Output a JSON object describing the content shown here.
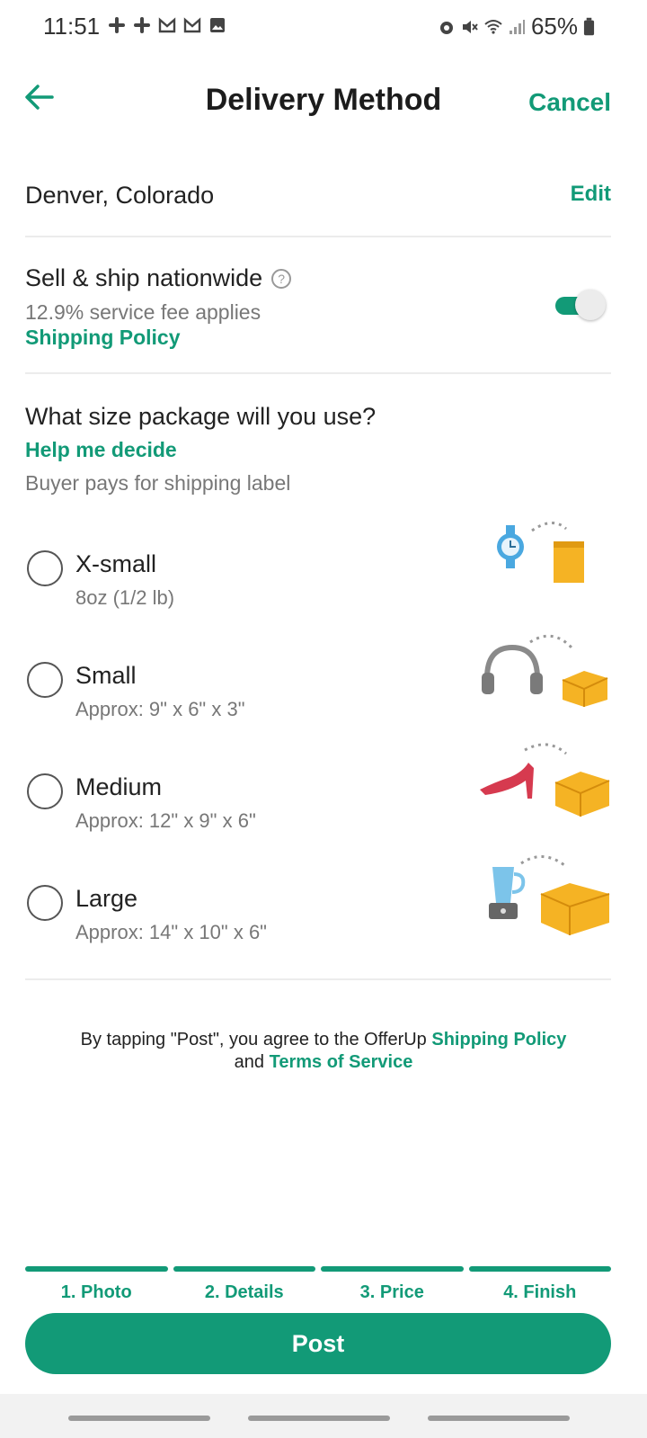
{
  "status_bar": {
    "time": "11:51",
    "battery": "65%",
    "left_icons": [
      "slack-icon",
      "slack-icon",
      "gmail-icon",
      "gmail-icon",
      "gallery-icon"
    ],
    "right_icons": [
      "alarm-icon",
      "mute-icon",
      "wifi-icon",
      "signal-icon",
      "battery-icon"
    ]
  },
  "header": {
    "title": "Delivery Method",
    "cancel_label": "Cancel",
    "back_icon": "arrow-left-icon"
  },
  "location": {
    "text": "Denver, Colorado",
    "edit_label": "Edit"
  },
  "shipping": {
    "title": "Sell & ship nationwide",
    "help_symbol": "?",
    "fee_text": "12.9% service fee applies",
    "policy_link": "Shipping Policy",
    "toggle_on": true
  },
  "package": {
    "question": "What size package will you use?",
    "help_link": "Help me decide",
    "buyer_note": "Buyer pays for shipping label",
    "options": [
      {
        "label": "X-small",
        "sub": "8oz (1/2 lb)",
        "illustration": "watch-and-package-icon"
      },
      {
        "label": "Small",
        "sub": "Approx: 9\" x 6\" x 3\"",
        "illustration": "headphones-and-box-icon"
      },
      {
        "label": "Medium",
        "sub": "Approx: 12\" x 9\" x 6\"",
        "illustration": "heel-and-box-icon"
      },
      {
        "label": "Large",
        "sub": "Approx: 14\" x 10\" x 6\"",
        "illustration": "blender-and-box-icon"
      }
    ]
  },
  "legal": {
    "prefix": "By tapping \"Post\", you agree to the OfferUp ",
    "policy_link": "Shipping Policy",
    "and_text": "and ",
    "terms_link": "Terms of Service"
  },
  "steps": [
    "1. Photo",
    "2. Details",
    "3. Price",
    "4. Finish"
  ],
  "post_label": "Post",
  "colors": {
    "accent": "#129a77",
    "package_yellow": "#f5b324",
    "heel_red": "#d63a4f",
    "watch_blue": "#4aa8e0"
  }
}
